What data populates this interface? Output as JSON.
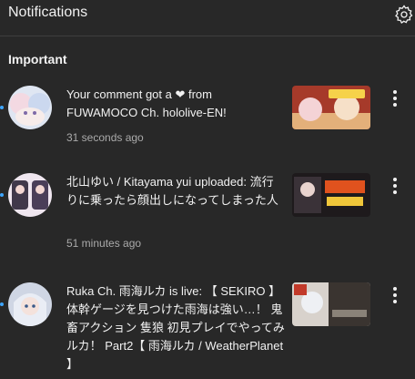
{
  "header": {
    "title": "Notifications",
    "settings_icon": "gear-icon"
  },
  "section": {
    "label": "Important"
  },
  "notifications": [
    {
      "text": "Your comment got a ❤ from FUWAMOCO Ch. hololive-EN!",
      "time": "31 seconds ago",
      "unread": true
    },
    {
      "text": "北山ゆい / Kitayama yui uploaded: 流行りに乗ったら顔出しになってしまった人",
      "time": "51 minutes ago",
      "unread": true
    },
    {
      "text": "Ruka Ch. 雨海ルカ is live: 【 SEKIRO 】体幹ゲージを見つけた雨海は強い…！ 鬼畜アクション 隻狼 初見プレイでやってみルカ！ Part2【 雨海ルカ / WeatherPlanet 】",
      "time": "",
      "unread": true
    }
  ],
  "colors": {
    "background": "#282828",
    "unread_dot": "#3ea6ff",
    "secondary_text": "#aaaaaa"
  }
}
